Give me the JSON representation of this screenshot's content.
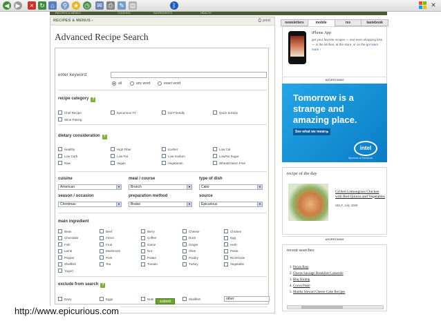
{
  "browser": {
    "toolbar_icons": [
      "back-icon",
      "forward-icon",
      "stop-icon",
      "refresh-icon",
      "home-icon",
      "search-icon",
      "favorites-icon",
      "history-icon",
      "mail-icon",
      "print-icon",
      "edit-icon",
      "discuss-icon",
      "bluetooth-icon"
    ],
    "close_glyph": "×"
  },
  "site_strip": [
    "RECIPES & MENUS",
    "COOKING",
    "INGREDIENTS",
    "HEALTH"
  ],
  "page": {
    "breadcrumb": "RECIPES & MENUS ›",
    "print_label": "print",
    "title": "Advanced Recipe Search"
  },
  "form": {
    "keyword_label": "enter keyword:",
    "keyword_value": "",
    "match_options": [
      {
        "label": "all",
        "selected": true
      },
      {
        "label": "any word",
        "selected": false
      },
      {
        "label": "exact word",
        "selected": false
      }
    ],
    "recipe_category": {
      "label": "recipe category",
      "options": [
        "Chef Recipe",
        "Epicurious TV",
        "Kid-Friendly",
        "Quick & Easy",
        "Wine Pairing"
      ]
    },
    "dietary": {
      "label": "dietary consideration",
      "options": [
        "Healthy",
        "High Fiber",
        "Kosher",
        "Low Cal",
        "Low Carb",
        "Low Fat",
        "Low Sodium",
        "Low/No Sugar",
        "Raw",
        "Vegan",
        "Vegetarian",
        "Wheat/Gluten Free"
      ]
    },
    "selects": [
      {
        "label": "cuisine",
        "value": "American"
      },
      {
        "label": "meal / course",
        "value": "Brunch"
      },
      {
        "label": "type of dish",
        "value": "Cake"
      },
      {
        "label": "season / occasion",
        "value": "Christmas"
      },
      {
        "label": "preparation method",
        "value": "Braise"
      },
      {
        "label": "source",
        "value": "Epicurious"
      }
    ],
    "main_ingredient": {
      "label": "main ingredient",
      "options": [
        "Bean",
        "Beef",
        "Berry",
        "Cheese",
        "Chicken",
        "Chocolate",
        "Citrus",
        "Coffee",
        "Duck",
        "Egg",
        "Fish",
        "Fruit",
        "Game",
        "Ginger",
        "Herb",
        "Lamb",
        "Mushroom",
        "Nut",
        "Olive",
        "Pasta",
        "Pepper",
        "Pork",
        "Potato",
        "Poultry",
        "Rice/Grain",
        "Shellfish",
        "Tea",
        "Tomato",
        "Turkey",
        "Vegetable",
        "Yogurt"
      ]
    },
    "exclude": {
      "label": "exclude from search",
      "options": [
        "Dairy",
        "Eggs",
        "Nuts",
        "Shellfish"
      ],
      "other_value": "other"
    },
    "help_glyph": "?",
    "submit_label": "submit"
  },
  "right": {
    "tabs": [
      {
        "label": "newsletters",
        "active": false
      },
      {
        "label": "mobile",
        "active": true
      },
      {
        "label": "rss",
        "active": false
      },
      {
        "label": "tastebook",
        "active": false
      }
    ],
    "mobile": {
      "title": "iPhone App",
      "desc": "get your favorite recipes — and even shopping lists — in the kitchen, at the store, or on the go!",
      "more": "learn more ›"
    },
    "ad_label": "ADVERTISING",
    "ad": {
      "headline": "Tomorrow is a strange and amazing place.",
      "cta": "See what we mean",
      "brand": "intel",
      "tagline": "Sponsors of Tomorrow."
    },
    "recipe_of_day": {
      "heading": "recipe of the day",
      "name": "Grilled Lemongrass Chicken with Red Quinoa and Vegetables",
      "source": "SELF, July 2008"
    },
    "recent": {
      "heading": "recent searches",
      "items": [
        {
          "num": "1.",
          "text": "Pecan Bars"
        },
        {
          "num": "2.",
          "text": "Owens Sausage Breakfast Casserole"
        },
        {
          "num": "3.",
          "text": "Bbq Shrimp"
        },
        {
          "num": "4.",
          "text": "Cocoa Paste"
        },
        {
          "num": "5.",
          "text": "Martha Stewart Cheese Cake Recipes"
        }
      ]
    }
  },
  "caption": "http://www.epicurious.com",
  "colors": {
    "accent_green": "#6aa32d",
    "site_dark_green": "#4b5a2e",
    "ad_blue": "#0a7cc6"
  }
}
